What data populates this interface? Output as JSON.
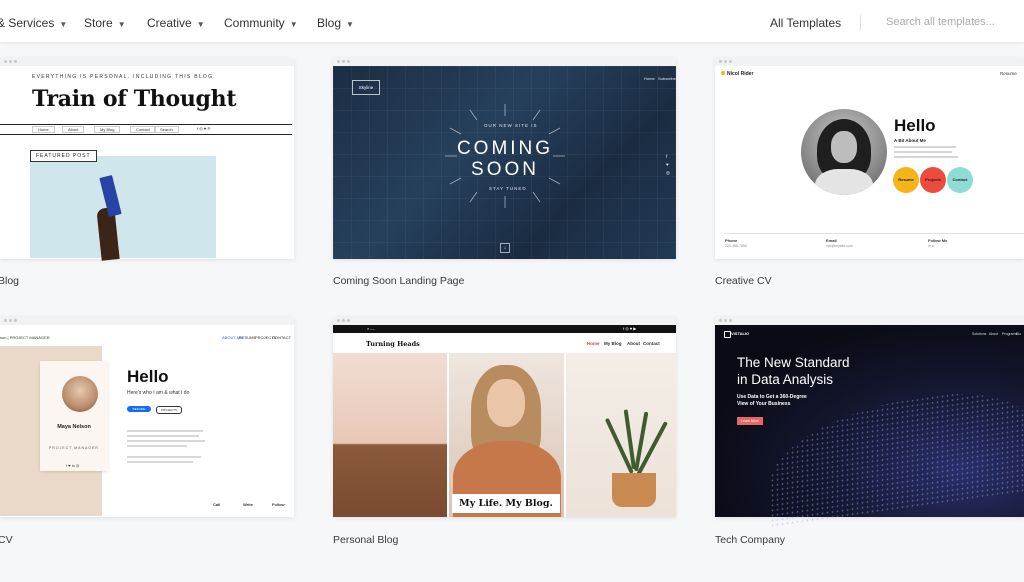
{
  "nav": {
    "items": [
      {
        "label": "& Services"
      },
      {
        "label": "Store"
      },
      {
        "label": "Creative"
      },
      {
        "label": "Community"
      },
      {
        "label": "Blog"
      }
    ],
    "chevron": "chevron-down-icon",
    "all_templates": "All Templates",
    "search_placeholder": "Search all templates..."
  },
  "cards": {
    "blog": {
      "title": "Blog",
      "tagline": "EVERYTHING IS PERSONAL. INCLUDING THIS BLOG.",
      "heading": "Train of Thought",
      "menu": [
        "Home",
        "About",
        "My Blog",
        "Contact",
        "Search"
      ],
      "featured": "FEATURED POST"
    },
    "coming_soon": {
      "title": "Coming Soon Landing Page",
      "logo": "Skyline",
      "nav": [
        "Home",
        "Subscribe"
      ],
      "kicker": "OUR NEW SITE IS",
      "headline_1": "COMING",
      "headline_2": "SOON",
      "footer_text": "STAY TUNED"
    },
    "creative_cv": {
      "title": "Creative CV",
      "name": "Nicol Rider",
      "resume_link": "Resume",
      "hello": "Hello",
      "about": "A Bit About Me",
      "circles": [
        {
          "label": "Resume",
          "color": "#f5b41a"
        },
        {
          "label": "Projects",
          "color": "#ee4b3e"
        },
        {
          "label": "Contact",
          "color": "#8fdbd6"
        }
      ],
      "footer": [
        {
          "label": "Phone",
          "value": "123-456-7890"
        },
        {
          "label": "Email",
          "value": "info@mysite.com"
        },
        {
          "label": "Follow Me",
          "value": "in ●"
        }
      ]
    },
    "cv": {
      "title": "CV",
      "header_left": "son  |  PROJECT MANAGER",
      "nav": [
        "ABOUT ME",
        "RESUME",
        "PROJECTS",
        "CONTACT"
      ],
      "name": "Maya Nelson",
      "role": "PROJECT MANAGER",
      "hello": "Hello",
      "subtitle": "Here's who I am & what I do",
      "buttons": [
        "RESUME",
        "PROJECTS"
      ],
      "footer": [
        "Call",
        "Write",
        "Follow"
      ]
    },
    "personal_blog": {
      "title": "Personal Blog",
      "brand": "Turning Heads",
      "nav": [
        "Home",
        "My Blog",
        "About",
        "Contact"
      ],
      "caption": "My Life. My Blog."
    },
    "tech_company": {
      "title": "Tech Company",
      "logo": "VISTALIO",
      "nav": [
        "Solutions",
        "About",
        "Programs",
        "Blo"
      ],
      "headline_1": "The New Standard",
      "headline_2": "in Data Analysis",
      "sub_1": "Use Data to Get a 360-Degree",
      "sub_2": "View of Your Business",
      "button": "Learn More"
    }
  },
  "colors": {
    "accent_blue": "#116dff",
    "page_bg": "#f6f7f9"
  }
}
